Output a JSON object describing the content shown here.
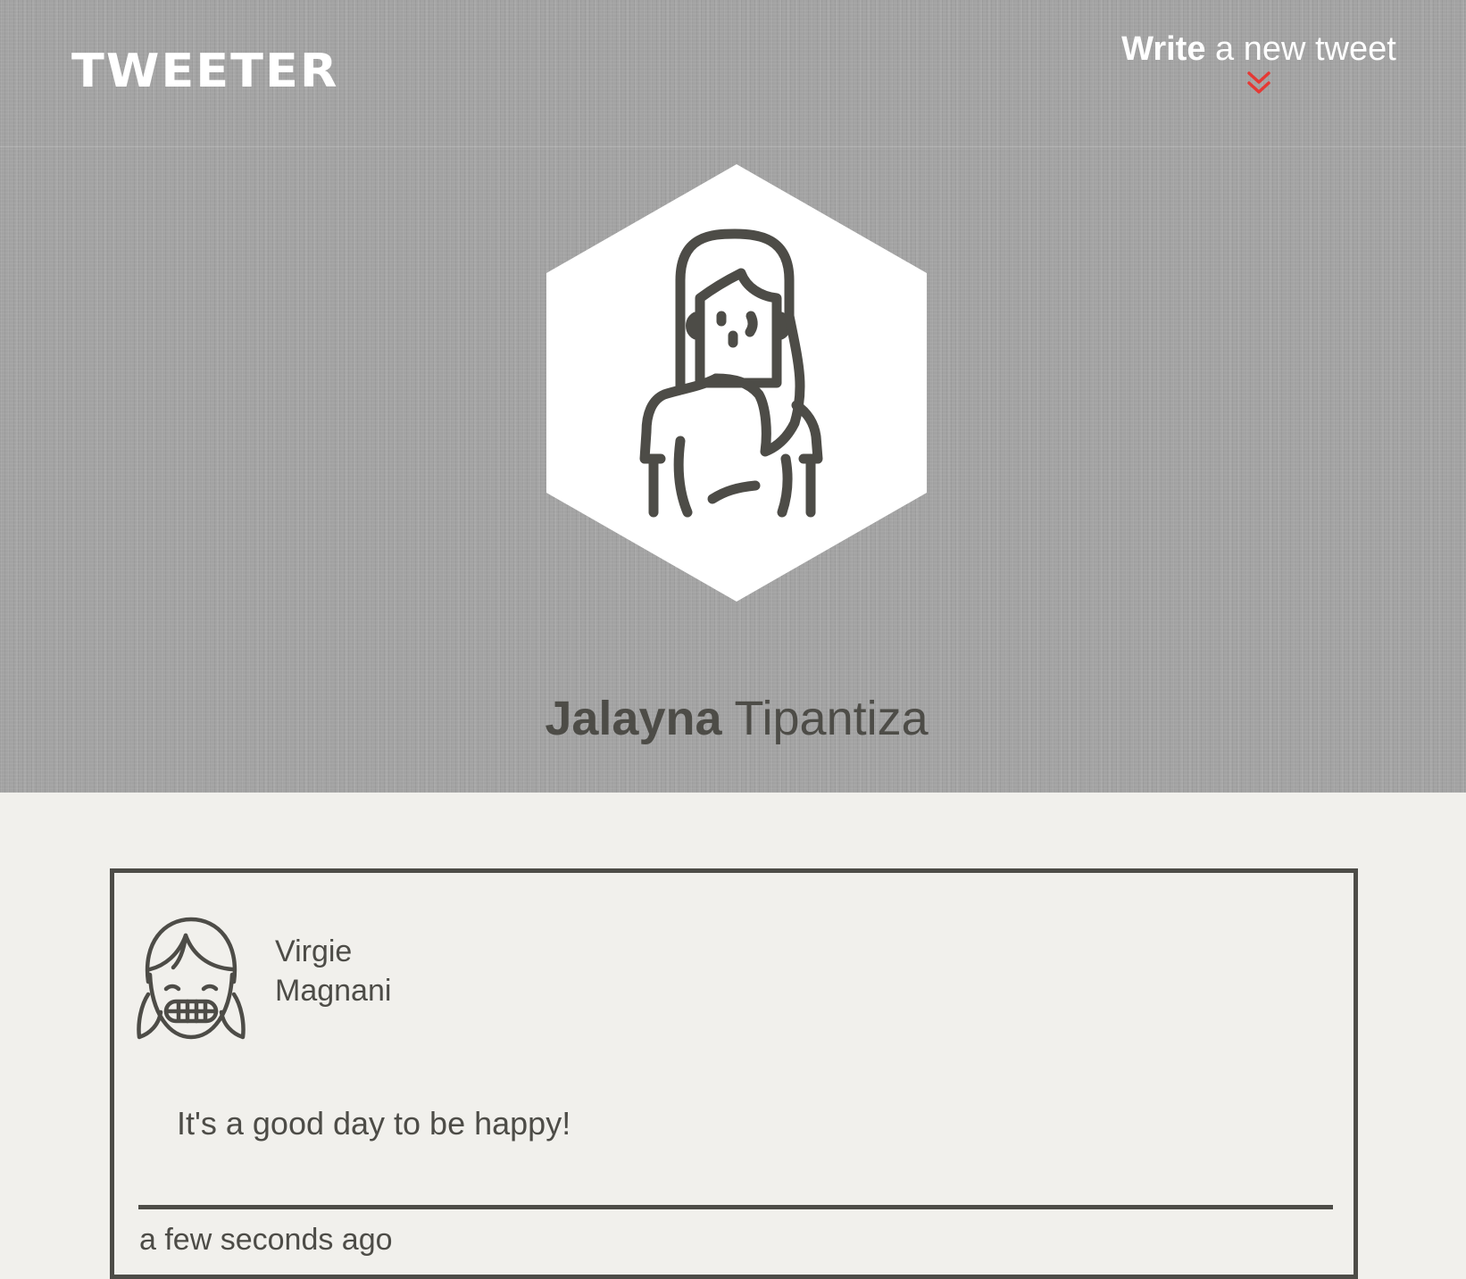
{
  "header": {
    "logo": "TWEETER",
    "compose_bold": "Write",
    "compose_rest": " a new tweet",
    "compose_icon": "double-chevron-down-icon"
  },
  "profile": {
    "first_name": "Jalayna",
    "last_name": "Tipantiza",
    "avatar_icon": "woman-avatar-icon"
  },
  "tweets": [
    {
      "author_first": "Virgie",
      "author_last": "Magnani",
      "avatar_icon": "smiling-girl-avatar-icon",
      "text": "It's a good day to be happy!",
      "time": "a few seconds ago"
    }
  ],
  "colors": {
    "accent": "#e53935",
    "ink": "#4d4c47",
    "hero_bg": "#a3a3a3",
    "page_bg": "#f1f0ec"
  }
}
